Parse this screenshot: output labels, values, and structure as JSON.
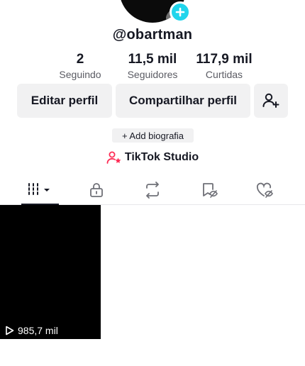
{
  "profile": {
    "username": "@obartman"
  },
  "stats": [
    {
      "value": "2",
      "label": "Seguindo"
    },
    {
      "value": "11,5 mil",
      "label": "Seguidores"
    },
    {
      "value": "117,9 mil",
      "label": "Curtidas"
    }
  ],
  "actions": {
    "edit_profile": "Editar perfil",
    "share_profile": "Compartilhar perfil"
  },
  "bio": {
    "add_label": "+ Add biografia"
  },
  "studio": {
    "label": "TikTok Studio",
    "accent_color": "#fe2c55"
  },
  "tabs": [
    {
      "icon": "grid-icon",
      "active": true
    },
    {
      "icon": "lock-icon",
      "active": false
    },
    {
      "icon": "repost-icon",
      "active": false
    },
    {
      "icon": "bookmark-hidden-icon",
      "active": false
    },
    {
      "icon": "heart-hidden-icon",
      "active": false
    }
  ],
  "videos": [
    {
      "views": "985,7 mil"
    }
  ]
}
